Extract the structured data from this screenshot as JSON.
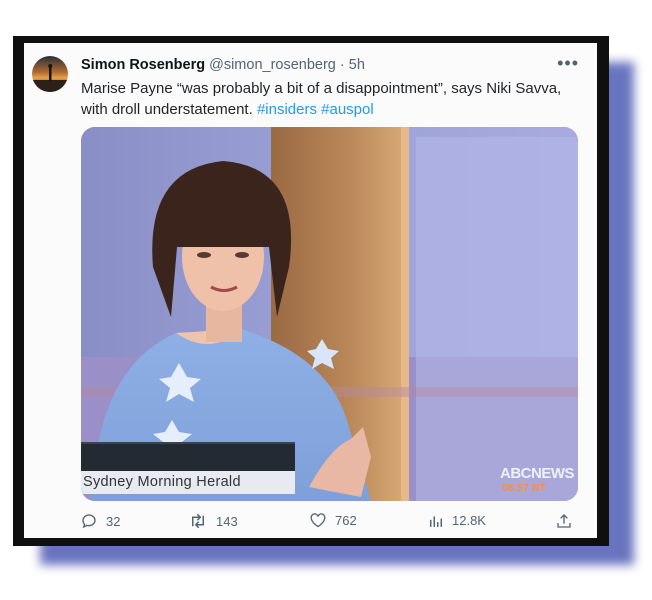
{
  "tweet": {
    "display_name": "Simon Rosenberg",
    "handle": "@simon_rosenberg",
    "separator": "·",
    "time": "5h",
    "more_label": "•••",
    "text_main": "Marise Payne “was probably a bit of a disappointment”, says Niki Savva, with droll understatement.",
    "hashtags": [
      "#insiders",
      "#auspol"
    ]
  },
  "media": {
    "lower_third": "Sydney Morning Herald",
    "channel_logo": "ABCNEWS",
    "clock": "08:57 NT"
  },
  "actions": {
    "replies": "32",
    "reposts": "143",
    "likes": "762",
    "views": "12.8K"
  },
  "icons": [
    "reply-icon",
    "repost-icon",
    "like-icon",
    "views-icon",
    "share-icon",
    "more-icon"
  ],
  "colors": {
    "hashtag": "#1d9bf0",
    "frame_shadow": "#4f5cb3",
    "abc_clock": "#ff8c3a"
  }
}
